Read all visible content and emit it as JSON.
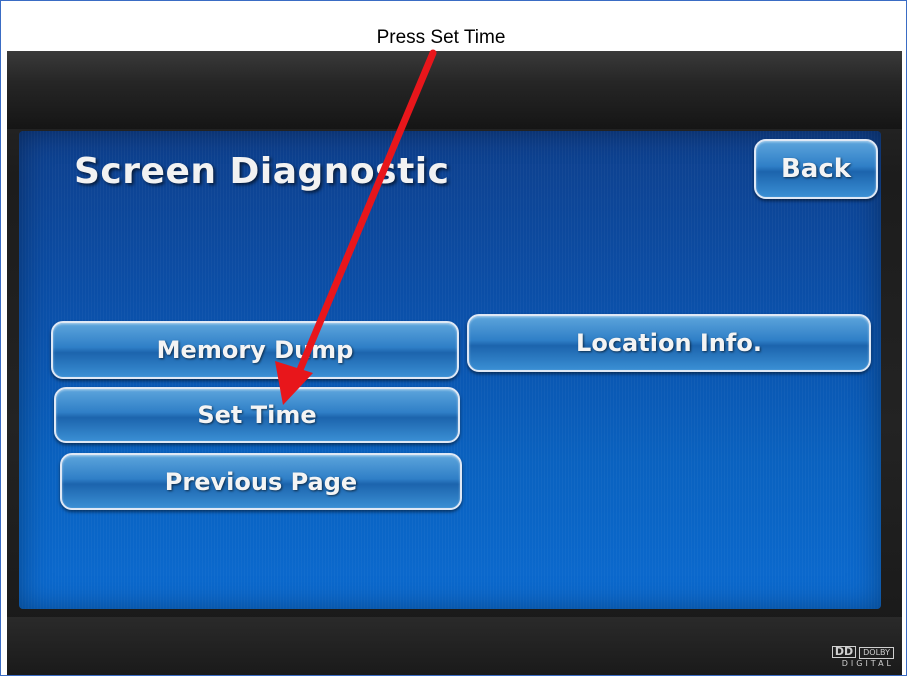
{
  "callout": {
    "text": "Press Set Time",
    "arrow_color": "#e8161b"
  },
  "screen": {
    "title": "Screen Diagnostic",
    "back_label": "Back",
    "buttons": {
      "memory_dump": "Memory Dump",
      "location_info": "Location Info.",
      "set_time": "Set Time",
      "previous_page": "Previous Page"
    },
    "background_color": "#0b4fa8",
    "button_color": "#2f7fc7"
  },
  "device": {
    "logo_dd": "DD",
    "logo_brand": "DOLBY",
    "logo_sub": "DIGITAL"
  }
}
